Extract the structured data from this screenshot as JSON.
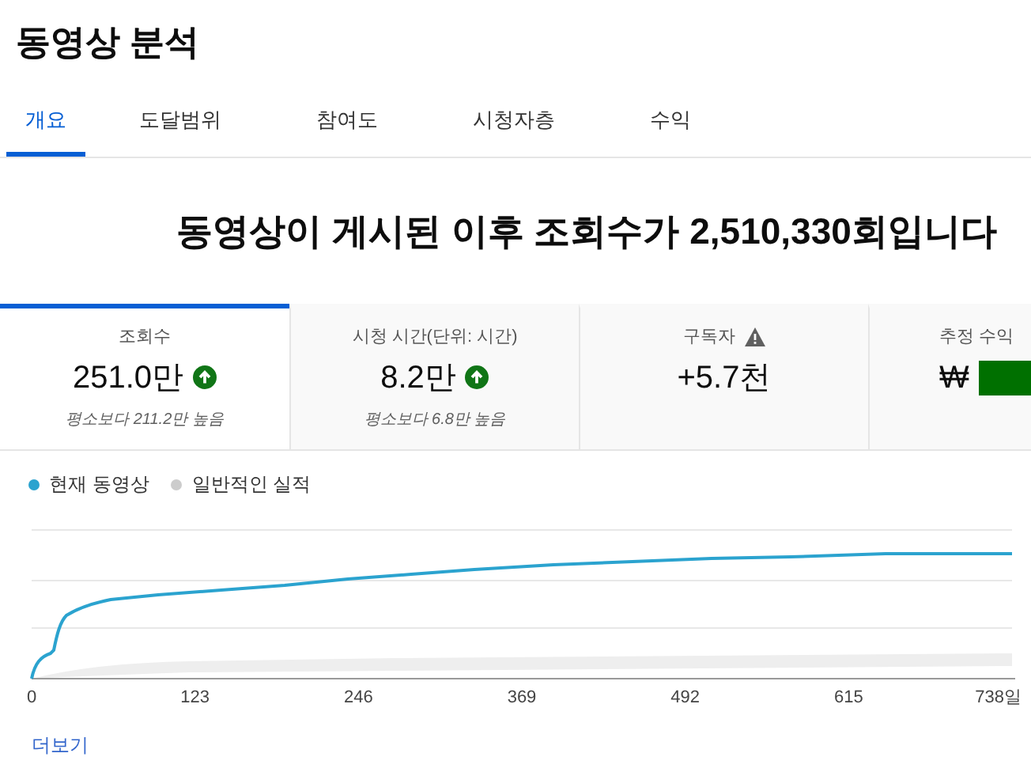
{
  "page_title": "동영상 분석",
  "tabs": [
    {
      "label": "개요",
      "selected": true
    },
    {
      "label": "도달범위",
      "selected": false
    },
    {
      "label": "참여도",
      "selected": false
    },
    {
      "label": "시청자층",
      "selected": false
    },
    {
      "label": "수익",
      "selected": false
    }
  ],
  "headline": "동영상이 게시된 이후 조회수가 **2,510,330**회입니다",
  "metrics": [
    {
      "label": "조회수",
      "value": "251.0만",
      "trend_up": true,
      "note": "평소보다 211.2만 높음",
      "selected": true
    },
    {
      "label": "시청 시간(단위: 시간)",
      "value": "8.2만",
      "trend_up": true,
      "note": "평소보다 6.8만 높음",
      "selected": false
    },
    {
      "label": "구독자",
      "warning": true,
      "value": "+5.7천",
      "selected": false
    },
    {
      "label": "추정 수익",
      "value": "₩",
      "redacted": true,
      "selected": false
    }
  ],
  "chart": {
    "legend": [
      {
        "label": "현재 동영상",
        "color": "#2ba3cf"
      },
      {
        "label": "일반적인 실적",
        "color": "#cccccc"
      }
    ],
    "x_labels": [
      "0",
      "123",
      "246",
      "369",
      "492",
      "615",
      "738일"
    ]
  },
  "more_link": "더보기"
}
